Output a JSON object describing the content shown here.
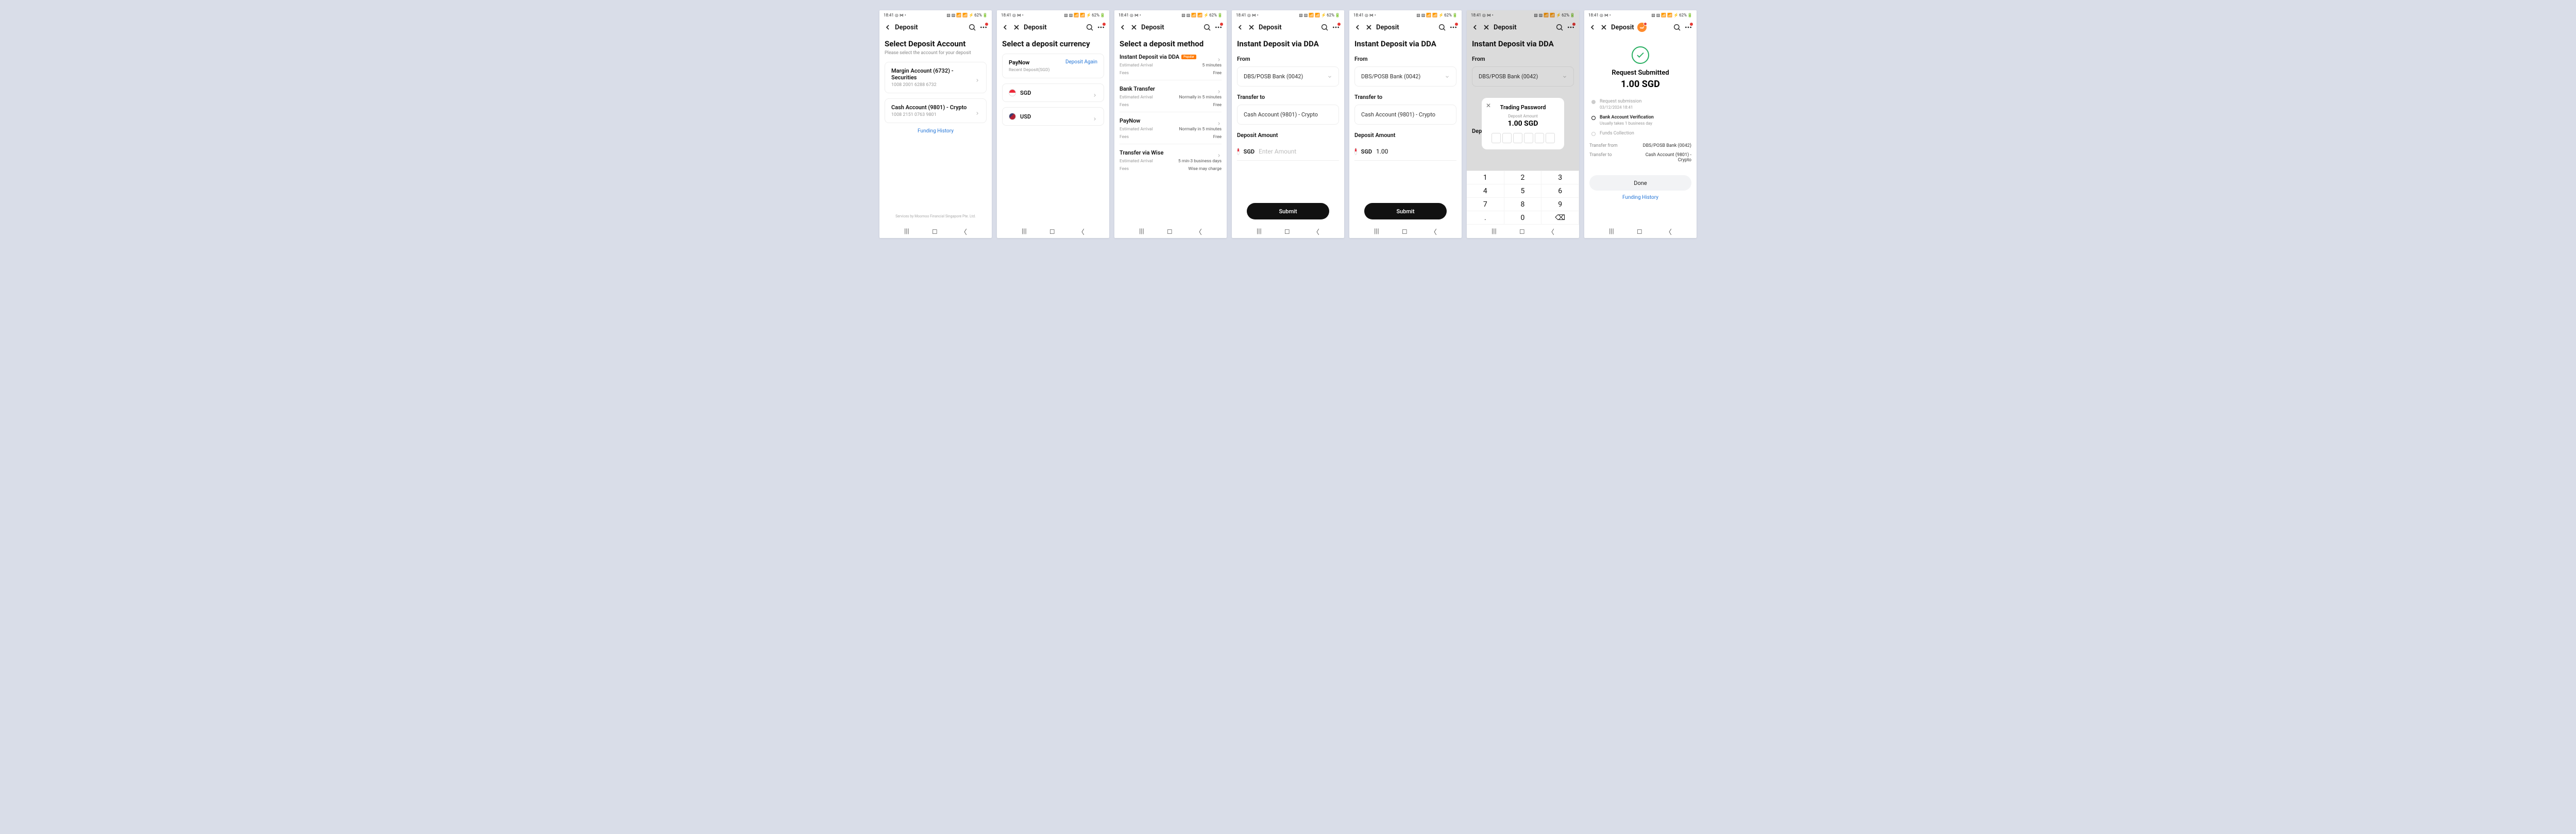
{
  "status": {
    "time": "18:41",
    "left_icons": "◎ ⋈ •",
    "right_icons": "▧ ▨ 📶 📶 ⚡",
    "battery": "62%"
  },
  "titles": {
    "deposit": "Deposit"
  },
  "screen1": {
    "title": "Select Deposit Account",
    "subtitle": "Please select the account for your deposit",
    "accounts": [
      {
        "name": "Margin Account (6732) - Securities",
        "number": "1008 2001 6288 6732"
      },
      {
        "name": "Cash Account (9801) - Crypto",
        "number": "1008 2151 0763 9801"
      }
    ],
    "funding_history": "Funding History",
    "footnote": "Services by Moomoo Financial Singapore Pte. Ltd."
  },
  "screen2": {
    "title": "Select a deposit currency",
    "paynow": {
      "label": "PayNow",
      "action": "Deposit Again",
      "sub": "Recent Deposit(SGD)"
    },
    "currencies": [
      {
        "code": "SGD"
      },
      {
        "code": "USD"
      }
    ]
  },
  "screen3": {
    "title": "Select a deposit method",
    "methods": [
      {
        "name": "Instant Deposit via DDA",
        "badge": "Popular",
        "est_label": "Estimated Arrival",
        "est": "5 minutes",
        "fee_label": "Fees",
        "fee": "Free"
      },
      {
        "name": "Bank Transfer",
        "est_label": "Estimated Arrival",
        "est": "Normally in 5 minutes",
        "fee_label": "Fees",
        "fee": "Free"
      },
      {
        "name": "PayNow",
        "est_label": "Estimated Arrival",
        "est": "Normally in 5 minutes",
        "fee_label": "Fees",
        "fee": "Free"
      },
      {
        "name": "Transfer via Wise",
        "est_label": "Estimated Arrival",
        "est": "5 min-3 business days",
        "fee_label": "Fees",
        "fee": "Wise may charge"
      }
    ]
  },
  "dda": {
    "title": "Instant Deposit via DDA",
    "from_label": "From",
    "from_value": "DBS/POSB Bank (0042)",
    "to_label": "Transfer to",
    "to_value": "Cash Account (9801) - Crypto",
    "amount_label": "Deposit Amount",
    "currency": "SGD",
    "placeholder": "Enter Amount",
    "filled_value": "1.00",
    "submit": "Submit"
  },
  "keypad": {
    "keys": [
      "1",
      "2",
      "3",
      "4",
      "5",
      "6",
      "7",
      "8",
      "9",
      ".",
      "0",
      "⌫"
    ]
  },
  "modal": {
    "title": "Trading Password",
    "sub": "Deposit Amount",
    "amount": "1.00 SGD"
  },
  "screen7": {
    "success_title": "Request Submitted",
    "amount": "1.00 SGD",
    "timeline": [
      {
        "t1": "Request submission",
        "t2": "03/12/2024 18:41",
        "state": "done"
      },
      {
        "t1": "Bank Account Verification",
        "t2": "Usually takes 1 business day",
        "state": "active"
      },
      {
        "t1": "Funds Collection",
        "t2": "",
        "state": "pending"
      }
    ],
    "transfer_from_label": "Transfer from",
    "transfer_from_value": "DBS/POSB Bank (0042)",
    "transfer_to_label": "Transfer to",
    "transfer_to_value": "Cash Account (9801) - Crypto",
    "done": "Done",
    "funding_history": "Funding History"
  }
}
